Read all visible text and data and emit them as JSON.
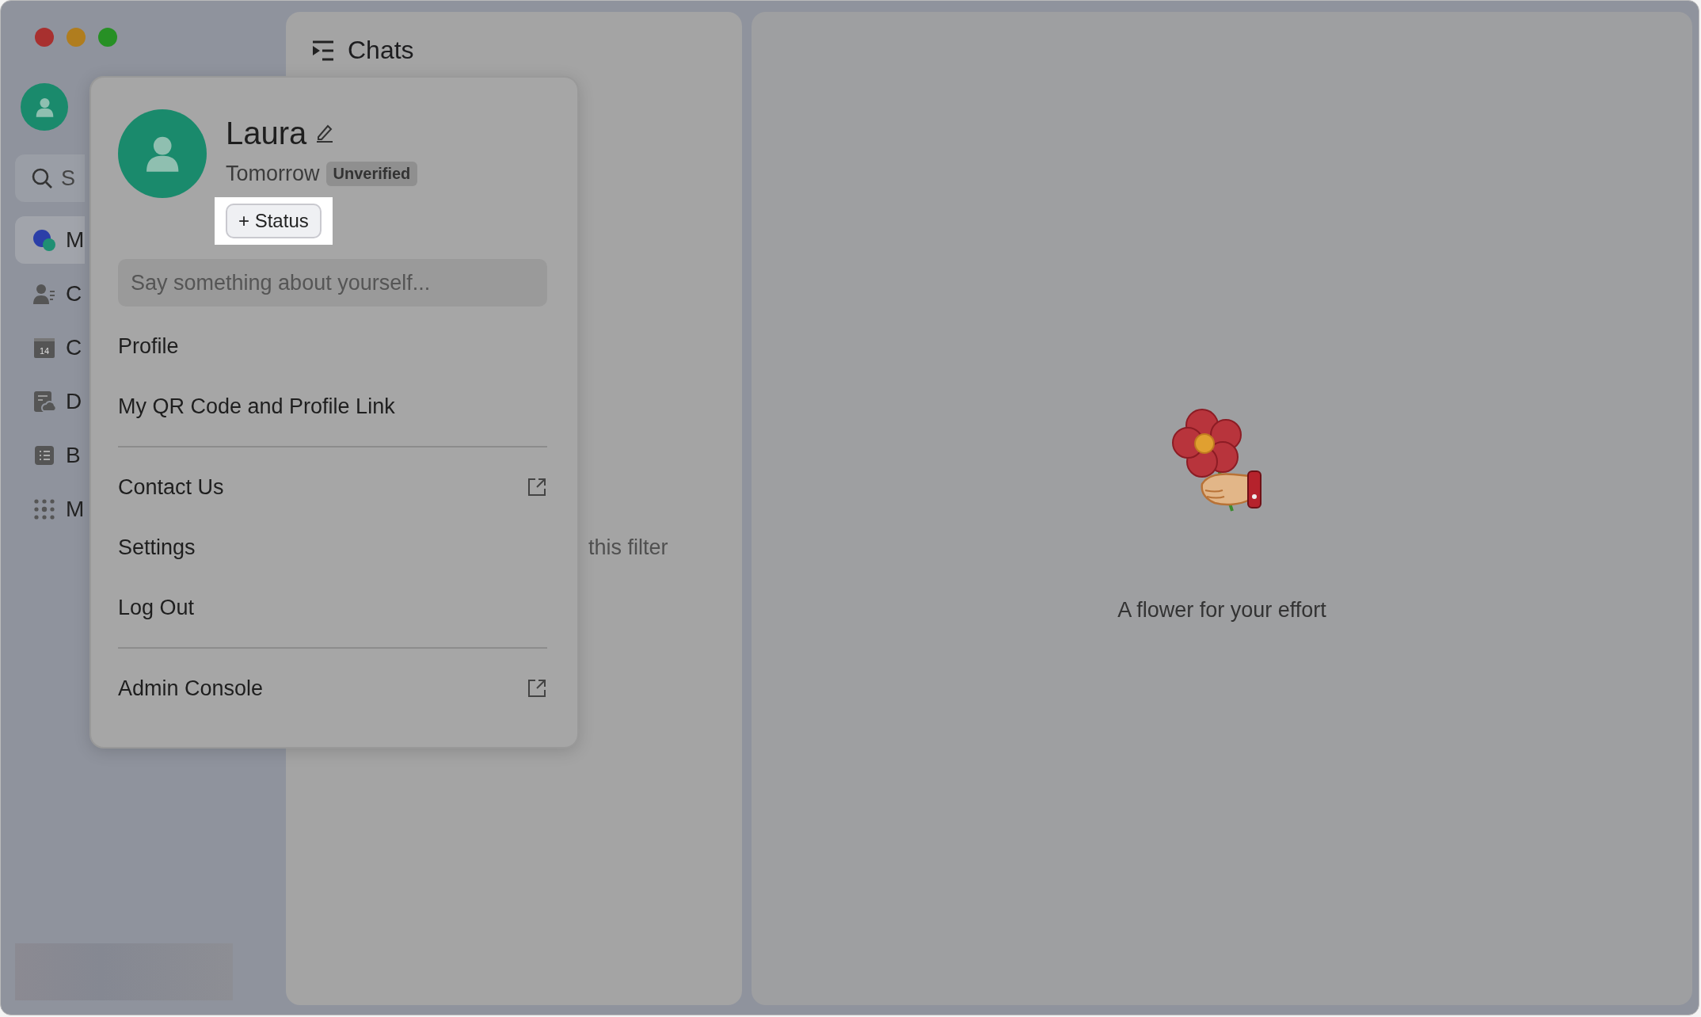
{
  "sidebar": {
    "search": {
      "placeholder": "S"
    },
    "items": [
      {
        "kind": "messenger",
        "label": "M",
        "selected": true
      },
      {
        "kind": "contacts",
        "label": "C",
        "selected": false
      },
      {
        "kind": "calendar",
        "label": "C",
        "selected": false,
        "icon_text": "14"
      },
      {
        "kind": "docs",
        "label": "D",
        "selected": false
      },
      {
        "kind": "base",
        "label": "B",
        "selected": false
      },
      {
        "kind": "more",
        "label": "M",
        "selected": false
      }
    ]
  },
  "chats_panel": {
    "title": "Chats",
    "empty_text": "this filter"
  },
  "main": {
    "caption": "A flower for your effort"
  },
  "profile_menu": {
    "name": "Laura",
    "status": "Tomorrow",
    "badge": "Unverified",
    "status_button": "+ Status",
    "bio": {
      "placeholder": "Say something about yourself..."
    },
    "groups": [
      [
        {
          "label": "Profile",
          "external": false
        },
        {
          "label": "My QR Code and Profile Link",
          "external": false
        }
      ],
      [
        {
          "label": "Contact Us",
          "external": true
        },
        {
          "label": "Settings",
          "external": false
        },
        {
          "label": "Log Out",
          "external": false
        }
      ],
      [
        {
          "label": "Admin Console",
          "external": true
        }
      ]
    ]
  }
}
